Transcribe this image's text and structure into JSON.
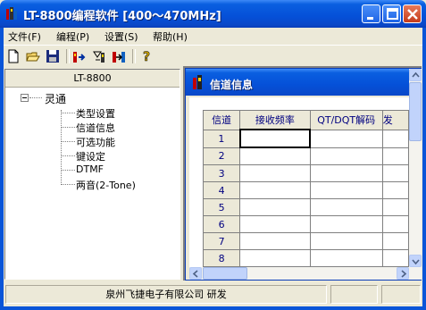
{
  "window": {
    "title": "LT-8800编程软件 [400～470MHz]"
  },
  "menu": [
    {
      "label": "文件(F)"
    },
    {
      "label": "编程(P)"
    },
    {
      "label": "设置(S)"
    },
    {
      "label": "帮助(H)"
    }
  ],
  "toolbar": {
    "icons": [
      "new-file-icon",
      "open-folder-icon",
      "save-disk-icon",
      "read-radio-icon",
      "write-radio-icon",
      "clone-radio-icon",
      "help-icon"
    ]
  },
  "tree": {
    "header": "LT-8800",
    "root": "灵通",
    "children": [
      "类型设置",
      "信道信息",
      "可选功能",
      "键设定",
      "DTMF",
      "两音(2-Tone)"
    ]
  },
  "child_window": {
    "title": "信道信息"
  },
  "grid": {
    "columns": [
      "信道",
      "接收频率",
      "QT/DQT解码",
      "发"
    ],
    "rows": [
      "1",
      "2",
      "3",
      "4",
      "5",
      "6",
      "7",
      "8"
    ]
  },
  "status": {
    "company": "泉州飞捷电子有限公司 研发"
  },
  "colors": {
    "titlebar": "#0a55d8",
    "face": "#ece9d8",
    "grid_text": "#000080"
  }
}
